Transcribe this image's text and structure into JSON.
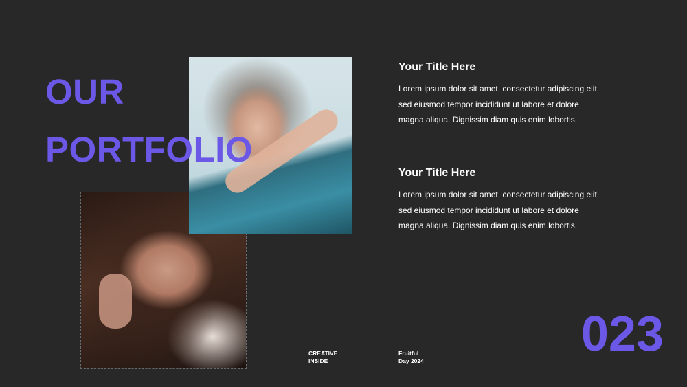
{
  "heading": {
    "line1": "OUR",
    "line2": "PORTFOLIO"
  },
  "blocks": [
    {
      "title": "Your Title Here",
      "lines": [
        "Lorem ipsum dolor sit amet, consectetur adipiscing elit,",
        "sed eiusmod tempor incididunt ut labore et dolore",
        "magna aliqua. Dignissim diam quis enim lobortis."
      ]
    },
    {
      "title": "Your Title Here",
      "lines": [
        "Lorem ipsum dolor sit amet, consectetur adipiscing elit,",
        "sed eiusmod tempor incididunt ut labore et dolore",
        "magna aliqua. Dignissim diam quis enim lobortis."
      ]
    }
  ],
  "footer": {
    "left": {
      "line1": "CREATIVE",
      "line2": "INSIDE"
    },
    "right": {
      "line1": "Fruitful",
      "line2": "Day 2024"
    }
  },
  "page_number": "023",
  "colors": {
    "background": "#282828",
    "accent": "#6c58e6",
    "text": "#ffffff"
  }
}
